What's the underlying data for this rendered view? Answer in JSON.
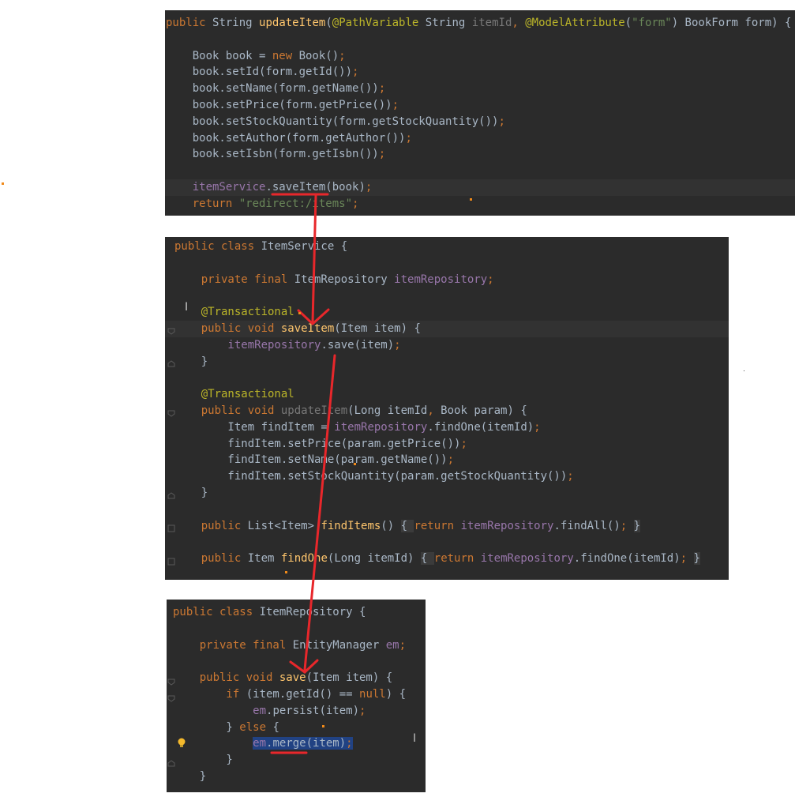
{
  "controller_panel": {
    "lines": [
      [
        [
          "kw",
          "public "
        ],
        [
          "plain",
          "String "
        ],
        [
          "fn",
          "updateItem"
        ],
        [
          "plain",
          "("
        ],
        [
          "ann",
          "@PathVariable "
        ],
        [
          "plain",
          "String "
        ],
        [
          "par",
          "itemId"
        ],
        [
          "kw",
          ", "
        ],
        [
          "ann",
          "@ModelAttribute"
        ],
        [
          "plain",
          "("
        ],
        [
          "str",
          "\"form\""
        ],
        [
          "plain",
          ") BookForm form) {"
        ]
      ],
      [],
      [
        [
          "plain",
          "    Book book = "
        ],
        [
          "kw",
          "new "
        ],
        [
          "plain",
          "Book()"
        ],
        [
          "kw",
          ";"
        ]
      ],
      [
        [
          "plain",
          "    book.setId(form.getId())"
        ],
        [
          "kw",
          ";"
        ]
      ],
      [
        [
          "plain",
          "    book.setName(form.getName())"
        ],
        [
          "kw",
          ";"
        ]
      ],
      [
        [
          "plain",
          "    book.setPrice(form.getPrice())"
        ],
        [
          "kw",
          ";"
        ]
      ],
      [
        [
          "plain",
          "    book.setStockQuantity(form.getStockQuantity())"
        ],
        [
          "kw",
          ";"
        ]
      ],
      [
        [
          "plain",
          "    book.setAuthor(form.getAuthor())"
        ],
        [
          "kw",
          ";"
        ]
      ],
      [
        [
          "plain",
          "    book.setIsbn(form.getIsbn())"
        ],
        [
          "kw",
          ";"
        ]
      ],
      [],
      [
        [
          "fld",
          "    itemService"
        ],
        [
          "plain",
          ".saveItem(book)"
        ],
        [
          "kw",
          ";"
        ]
      ],
      [
        [
          "kw",
          "    return "
        ],
        [
          "str",
          "\"redirect:/items\""
        ],
        [
          "kw",
          ";"
        ]
      ]
    ]
  },
  "service_panel": {
    "lines": [
      [
        [
          "kw",
          "public class "
        ],
        [
          "plain",
          "ItemService {"
        ]
      ],
      [],
      [
        [
          "kw",
          "    private final "
        ],
        [
          "plain",
          "ItemRepository "
        ],
        [
          "fld",
          "itemRepository"
        ],
        [
          "kw",
          ";"
        ]
      ],
      [],
      [
        [
          "ann",
          "    @Transactional"
        ]
      ],
      [
        [
          "kw",
          "    public void "
        ],
        [
          "fn",
          "saveItem"
        ],
        [
          "plain",
          "(Item item) {"
        ]
      ],
      [
        [
          "fld",
          "        itemRepository"
        ],
        [
          "plain",
          ".save(item)"
        ],
        [
          "kw",
          ";"
        ]
      ],
      [
        [
          "plain",
          "    }"
        ]
      ],
      [],
      [
        [
          "ann",
          "    @Transactional"
        ]
      ],
      [
        [
          "kw",
          "    public void "
        ],
        [
          "par",
          "updateItem"
        ],
        [
          "plain",
          "(Long itemId"
        ],
        [
          "kw",
          ", "
        ],
        [
          "plain",
          "Book param) {"
        ]
      ],
      [
        [
          "plain",
          "        Item findItem = "
        ],
        [
          "fld",
          "itemRepository"
        ],
        [
          "plain",
          ".findOne(itemId)"
        ],
        [
          "kw",
          ";"
        ]
      ],
      [
        [
          "plain",
          "        findItem.setPrice(param.getPrice())"
        ],
        [
          "kw",
          ";"
        ]
      ],
      [
        [
          "plain",
          "        findItem.setName(param.getName())"
        ],
        [
          "kw",
          ";"
        ]
      ],
      [
        [
          "plain",
          "        findItem.setStockQuantity(param.getStockQuantity())"
        ],
        [
          "kw",
          ";"
        ]
      ],
      [
        [
          "plain",
          "    }"
        ]
      ],
      [],
      [
        [
          "kw",
          "    public "
        ],
        [
          "plain",
          "List<Item> "
        ],
        [
          "fn",
          "findItems"
        ],
        [
          "plain",
          "() "
        ],
        [
          "fold",
          "{ "
        ],
        [
          "kw",
          "return "
        ],
        [
          "fld",
          "itemRepository"
        ],
        [
          "plain",
          ".findAll()"
        ],
        [
          "kw",
          "; "
        ],
        [
          "fold",
          "}"
        ]
      ],
      [],
      [
        [
          "kw",
          "    public "
        ],
        [
          "plain",
          "Item "
        ],
        [
          "fn",
          "findOne"
        ],
        [
          "plain",
          "(Long itemId) "
        ],
        [
          "fold",
          "{ "
        ],
        [
          "kw",
          "return "
        ],
        [
          "fld",
          "itemRepository"
        ],
        [
          "plain",
          ".findOne(itemId)"
        ],
        [
          "kw",
          "; "
        ],
        [
          "fold",
          "}"
        ]
      ]
    ]
  },
  "repository_panel": {
    "lines": [
      [
        [
          "kw",
          "public class "
        ],
        [
          "plain",
          "ItemRepository {"
        ]
      ],
      [],
      [
        [
          "kw",
          "    private final "
        ],
        [
          "plain",
          "EntityManager "
        ],
        [
          "fld",
          "em"
        ],
        [
          "kw",
          ";"
        ]
      ],
      [],
      [
        [
          "kw",
          "    public void "
        ],
        [
          "fn",
          "save"
        ],
        [
          "plain",
          "(Item item) {"
        ]
      ],
      [
        [
          "kw",
          "        if "
        ],
        [
          "plain",
          "(item.getId() == "
        ],
        [
          "kw",
          "null"
        ],
        [
          "plain",
          ") {"
        ]
      ],
      [
        [
          "fld",
          "            em"
        ],
        [
          "plain",
          ".persist(item)"
        ],
        [
          "kw",
          ";"
        ]
      ],
      [
        [
          "plain",
          "        } "
        ],
        [
          "kw",
          "else "
        ],
        [
          "plain",
          "{"
        ]
      ],
      [
        [
          "plain",
          "            "
        ],
        [
          "sel:fld",
          "em"
        ],
        [
          "sel:plain",
          ".merge(item)"
        ],
        [
          "sel:kw",
          ";"
        ]
      ],
      [
        [
          "plain",
          "        }"
        ]
      ],
      [
        [
          "plain",
          "    }"
        ]
      ]
    ]
  },
  "colors": {
    "arrow": "#e8272b",
    "editor_bg": "#2b2b2b",
    "marker_dot": "#f08a1a"
  },
  "icons": {
    "gutter_fold": "fold-marker-icon",
    "intention_bulb": "lightbulb-icon",
    "text_cursor": "text-cursor-icon"
  }
}
